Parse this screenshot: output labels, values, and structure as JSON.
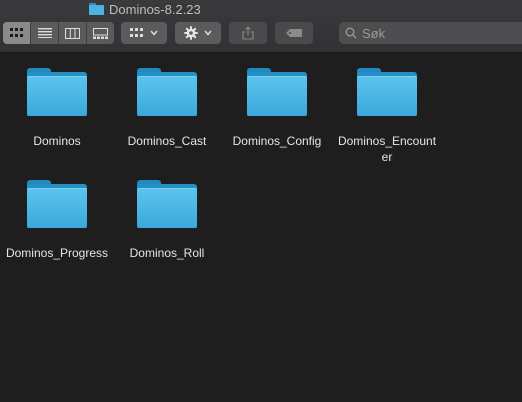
{
  "window": {
    "title": "Dominos-8.2.23",
    "title_icon": "folder-icon"
  },
  "toolbar": {
    "view_buttons": [
      {
        "name": "icon-view",
        "icon": "grid-icon",
        "active": true
      },
      {
        "name": "list-view",
        "icon": "list-icon",
        "active": false
      },
      {
        "name": "column-view",
        "icon": "columns-icon",
        "active": false
      },
      {
        "name": "gallery-view",
        "icon": "gallery-icon",
        "active": false
      }
    ],
    "group_icon": "group-grid-icon",
    "action_icon": "gear-icon",
    "share_icon": "share-icon",
    "tag_icon": "tag-icon"
  },
  "search": {
    "placeholder": "Søk"
  },
  "items": [
    {
      "label": "Dominos"
    },
    {
      "label": "Dominos_Cast"
    },
    {
      "label": "Dominos_Config"
    },
    {
      "label": "Dominos_Encounter"
    },
    {
      "label": "Dominos_Progress"
    },
    {
      "label": "Dominos_Roll"
    }
  ],
  "colors": {
    "folder": "#3aa8dc",
    "background": "#1e1e1e",
    "toolbar": "#3a3a3c"
  }
}
